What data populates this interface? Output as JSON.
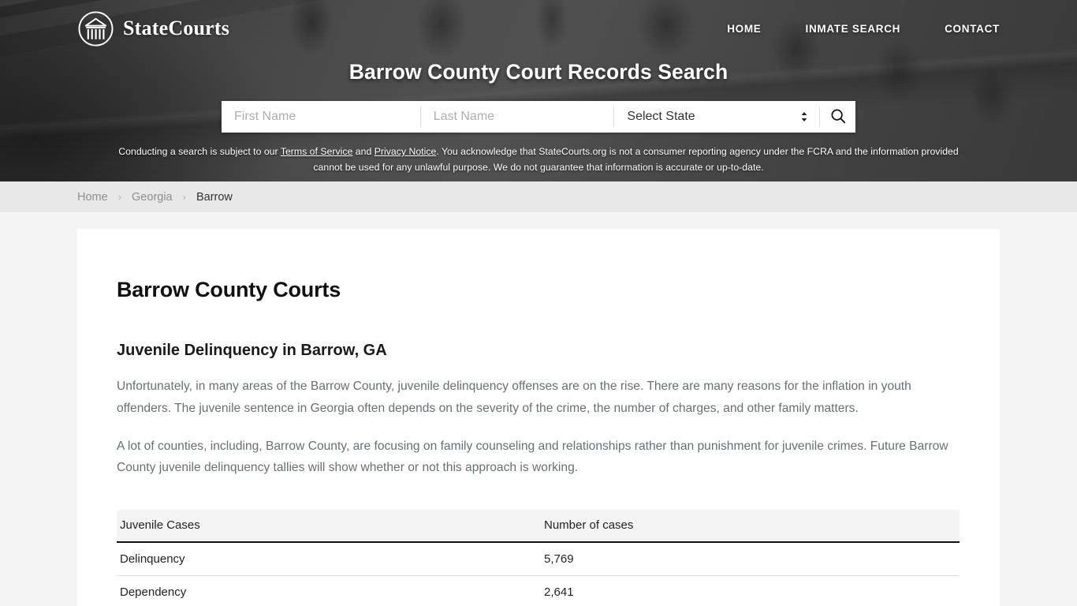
{
  "brand": {
    "name": "StateCourts",
    "logo_icon": "courthouse-circle-icon"
  },
  "nav": {
    "items": [
      {
        "label": "HOME"
      },
      {
        "label": "INMATE SEARCH"
      },
      {
        "label": "CONTACT"
      }
    ]
  },
  "hero": {
    "title": "Barrow County Court Records Search",
    "search": {
      "first_name_placeholder": "First Name",
      "first_name_value": "",
      "last_name_placeholder": "Last Name",
      "last_name_value": "",
      "state_selected": "Select State",
      "search_icon": "search-icon",
      "stepper_icon": "up-down-chevron-icon"
    },
    "disclaimer": {
      "part1": "Conducting a search is subject to our ",
      "link1": "Terms of Service",
      "part2": " and ",
      "link2": "Privacy Notice",
      "part3": ". You acknowledge that StateCourts.org is not a consumer reporting agency under the FCRA and the information provided cannot be used for any unlawful purpose. We do not guarantee that information is accurate or up-to-date."
    }
  },
  "breadcrumb": {
    "separator": "›",
    "items": [
      {
        "label": "Home",
        "current": false
      },
      {
        "label": "Georgia",
        "current": false
      },
      {
        "label": "Barrow",
        "current": true
      }
    ]
  },
  "main": {
    "page_title": "Barrow County Courts",
    "section_title": "Juvenile Delinquency in Barrow, GA",
    "paragraph1": "Unfortunately, in many areas of the Barrow County, juvenile delinquency offenses are on the rise. There are many reasons for the inflation in youth offenders. The juvenile sentence in Georgia often depends on the severity of the crime, the number of charges, and other family matters.",
    "paragraph2": "A lot of counties, including, Barrow County, are focusing on family counseling and relationships rather than punishment for juvenile crimes. Future Barrow County juvenile delinquency tallies will show whether or not this approach is working.",
    "table": {
      "headers": [
        "Juvenile Cases",
        "Number of cases"
      ],
      "rows": [
        {
          "label": "Delinquency",
          "value": "5,769"
        },
        {
          "label": "Dependency",
          "value": "2,641"
        }
      ]
    }
  },
  "colors": {
    "page_background": "#f4f4f4",
    "card_background": "#ffffff",
    "breadcrumb_background": "#e8e8e8",
    "body_text": "#6a6f73",
    "heading_text": "#111111"
  }
}
